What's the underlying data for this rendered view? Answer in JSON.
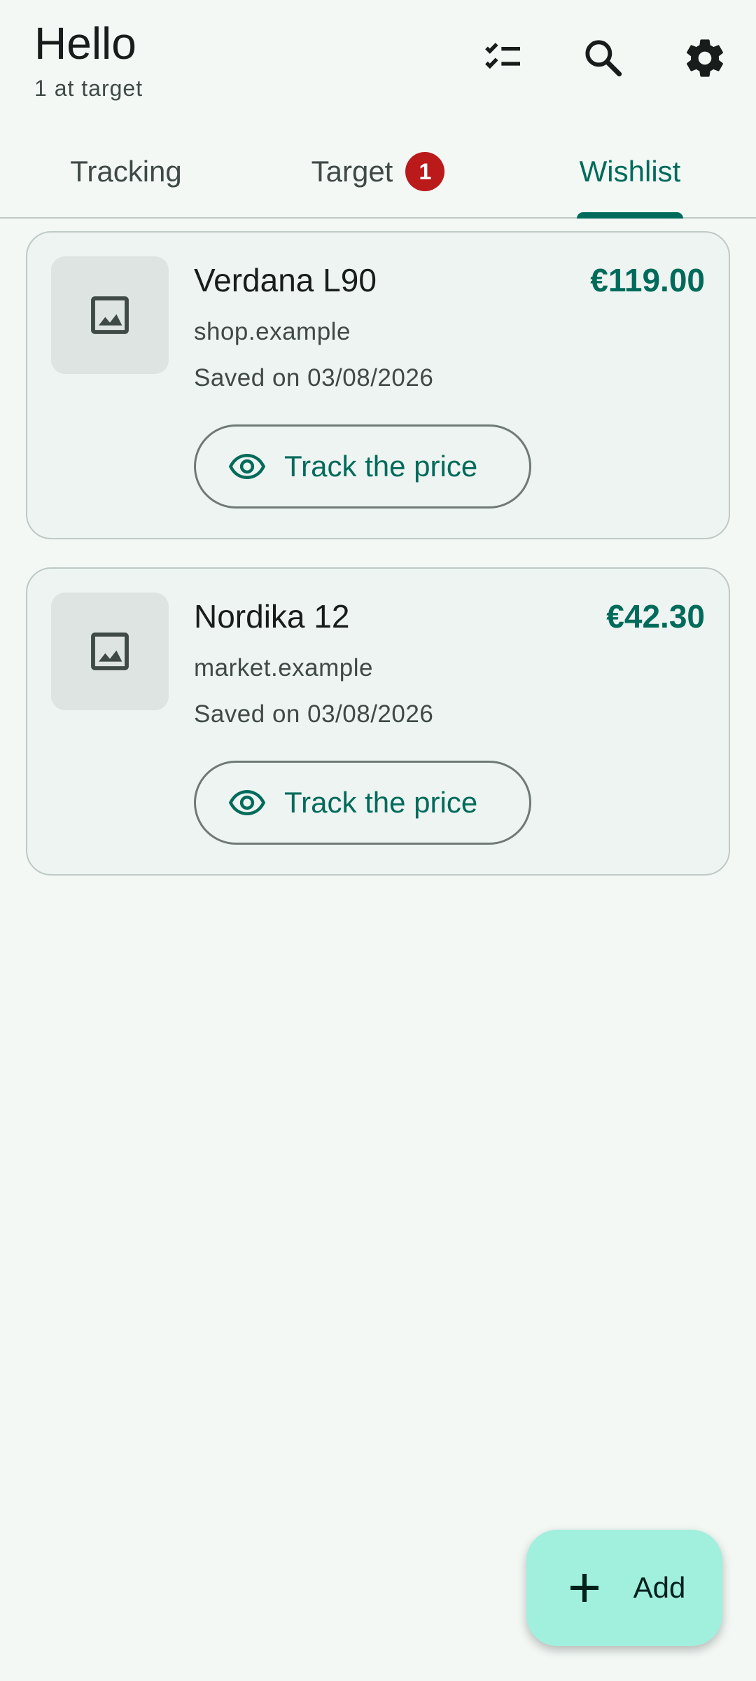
{
  "header": {
    "greeting": "Hello",
    "subtitle": "1 at target",
    "actions": [
      {
        "icon": "checklist-icon"
      },
      {
        "icon": "search-icon"
      },
      {
        "icon": "gear-icon"
      }
    ]
  },
  "tabs": [
    {
      "label": "Tracking",
      "selected": false
    },
    {
      "label": "Target",
      "badge": "1",
      "selected": false
    },
    {
      "label": "Wishlist",
      "selected": true
    }
  ],
  "items": [
    {
      "name": "Verdana L90",
      "price": "€119.00",
      "store": "shop.example",
      "saved": "Saved on 03/08/2026",
      "action": "Track the price"
    },
    {
      "name": "Nordika 12",
      "price": "€42.30",
      "store": "market.example",
      "saved": "Saved on 03/08/2026",
      "action": "Track the price"
    }
  ],
  "fab": {
    "label": "Add",
    "icon": "plus-icon"
  },
  "colors": {
    "accent": "#006b5b",
    "badge": "#ba1a1a",
    "fab": "#a1f0de",
    "background": "#f3f8f5"
  }
}
